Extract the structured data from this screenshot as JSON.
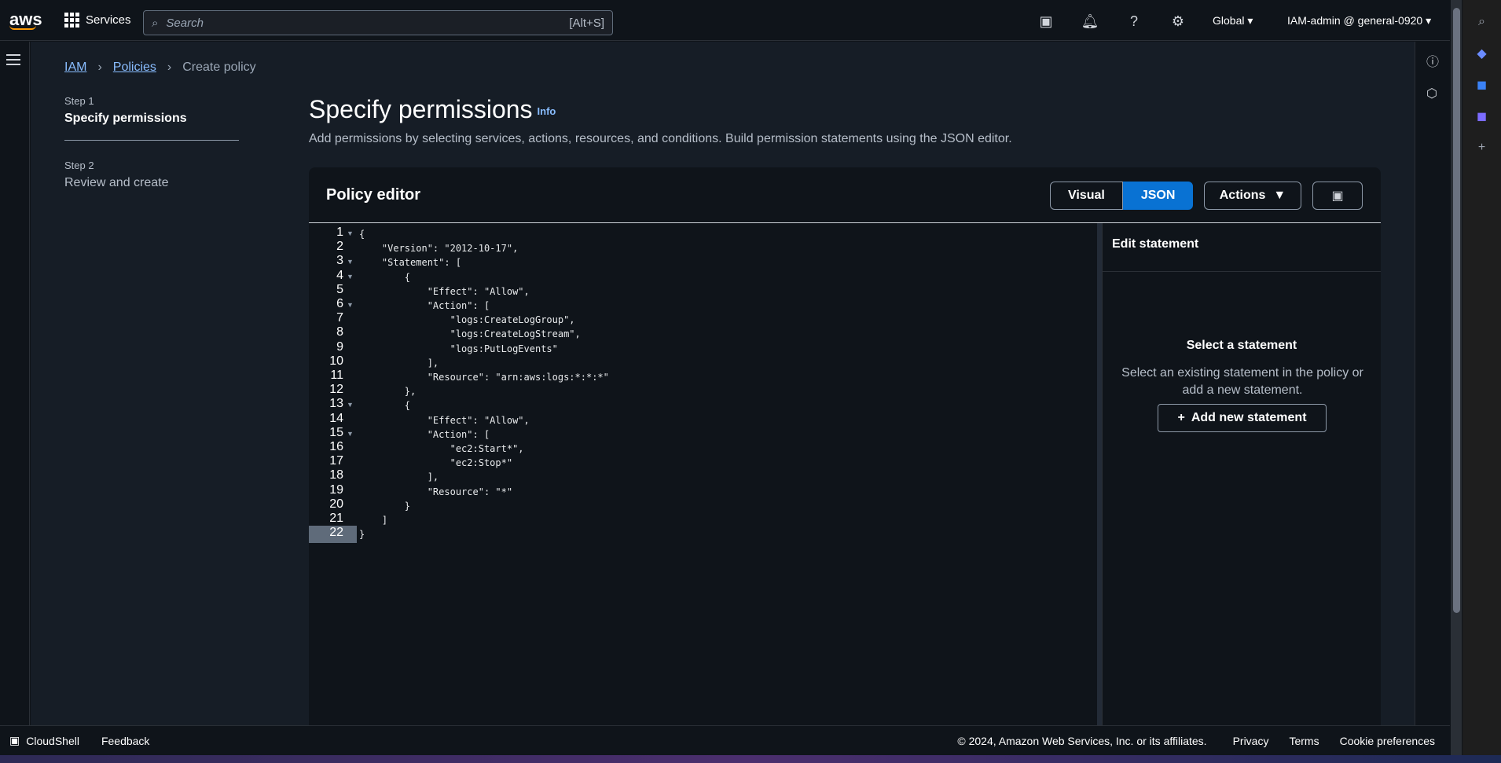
{
  "header": {
    "logo": "aws",
    "services_label": "Services",
    "search_placeholder": "Search",
    "search_shortcut": "[Alt+S]",
    "region": "Global",
    "account": "IAM-admin @ general-0920"
  },
  "breadcrumb": {
    "item1": "IAM",
    "item2": "Policies",
    "current": "Create policy"
  },
  "steps": [
    {
      "label": "Step 1",
      "title": "Specify permissions"
    },
    {
      "label": "Step 2",
      "title": "Review and create"
    }
  ],
  "page": {
    "title": "Specify permissions",
    "info": "Info",
    "description": "Add permissions by selecting services, actions, resources, and conditions. Build permission statements using the JSON editor."
  },
  "editor": {
    "title": "Policy editor",
    "visual_label": "Visual",
    "json_label": "JSON",
    "actions_label": "Actions"
  },
  "side": {
    "header": "Edit statement",
    "title": "Select a statement",
    "subtitle": "Select an existing statement in the policy or add a new statement.",
    "add_button": "Add new statement"
  },
  "footer": {
    "cloudshell": "CloudShell",
    "feedback": "Feedback",
    "copyright": "© 2024, Amazon Web Services, Inc. or its affiliates.",
    "privacy": "Privacy",
    "terms": "Terms",
    "cookies": "Cookie preferences"
  },
  "code_lines": [
    "{",
    "    \"Version\": \"2012-10-17\",",
    "    \"Statement\": [",
    "        {",
    "            \"Effect\": \"Allow\",",
    "            \"Action\": [",
    "                \"logs:CreateLogGroup\",",
    "                \"logs:CreateLogStream\",",
    "                \"logs:PutLogEvents\"",
    "            ],",
    "            \"Resource\": \"arn:aws:logs:*:*:*\"",
    "        },",
    "        {",
    "            \"Effect\": \"Allow\",",
    "            \"Action\": [",
    "                \"ec2:Start*\",",
    "                \"ec2:Stop*\"",
    "            ],",
    "            \"Resource\": \"*\"",
    "        }",
    "    ]",
    "}"
  ],
  "line_numbers": [
    "1",
    "2",
    "3",
    "4",
    "5",
    "6",
    "7",
    "8",
    "9",
    "10",
    "11",
    "12",
    "13",
    "14",
    "15",
    "16",
    "17",
    "18",
    "19",
    "20",
    "21",
    "22"
  ],
  "icons": {
    "cloudshell": "terminal-icon",
    "notifications": "bell-icon",
    "help": "help-icon",
    "settings": "gear-icon"
  }
}
